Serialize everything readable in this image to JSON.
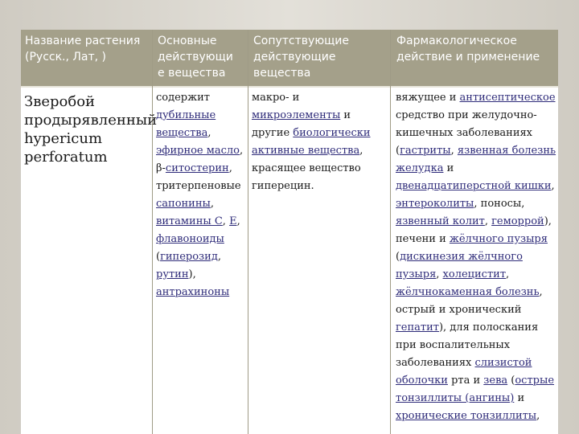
{
  "header": {
    "col1": "Название растения\n(Русск., Лат, )",
    "col2": "Основные\nдействующи\nе вещества",
    "col3": "Сопутствующие\nдействующие\nвещества",
    "col4": "Фармакологическое\nдействие и применение"
  },
  "plant": {
    "lines": [
      "Зверобой",
      "продырявленный",
      "hypericum",
      "perforatum"
    ]
  },
  "main_substances": {
    "lines": [
      [
        {
          "t": "содержит",
          "u": false
        }
      ],
      [
        {
          "t": "дубильные",
          "u": true
        }
      ],
      [
        {
          "t": "вещества",
          "u": true
        },
        {
          "t": ",",
          "u": false
        }
      ],
      [
        {
          "t": "эфирное масло",
          "u": true
        },
        {
          "t": ",",
          "u": false
        }
      ],
      [
        {
          "t": "β-",
          "u": false
        },
        {
          "t": "ситостерин",
          "u": true
        },
        {
          "t": ",",
          "u": false
        }
      ],
      [
        {
          "t": "тритерпеновые",
          "u": false
        }
      ],
      [
        {
          "t": "сапонины",
          "u": true
        },
        {
          "t": ",",
          "u": false
        }
      ],
      [
        {
          "t": "витамины С",
          "u": true
        },
        {
          "t": ", ",
          "u": false
        },
        {
          "t": "Е",
          "u": true
        },
        {
          "t": ",",
          "u": false
        }
      ],
      [
        {
          "t": "флавоноиды",
          "u": true
        }
      ],
      [
        {
          "t": "(",
          "u": false
        },
        {
          "t": "гиперозид",
          "u": true
        },
        {
          "t": ",",
          "u": false
        }
      ],
      [
        {
          "t": "рутин",
          "u": true
        },
        {
          "t": "),",
          "u": false
        }
      ],
      [
        {
          "t": "антрахиноны",
          "u": true
        }
      ]
    ]
  },
  "accompanying": {
    "lines": [
      [
        {
          "t": "макро- и",
          "u": false
        }
      ],
      [
        {
          "t": "микроэлементы",
          "u": true
        },
        {
          "t": " и",
          "u": false
        }
      ],
      [
        {
          "t": "другие ",
          "u": false
        },
        {
          "t": "биологически",
          "u": true
        }
      ],
      [
        {
          "t": "активные вещества",
          "u": true
        },
        {
          "t": ",",
          "u": false
        }
      ],
      [
        {
          "t": "красящее вещество",
          "u": false
        }
      ],
      [
        {
          "t": "гиперецин.",
          "u": false
        }
      ]
    ]
  },
  "action": {
    "lines": [
      [
        {
          "t": "вяжущее и ",
          "u": false
        },
        {
          "t": "антисептическое",
          "u": true
        }
      ],
      [
        {
          "t": "средство при желудочно-",
          "u": false
        }
      ],
      [
        {
          "t": "кишечных заболеваниях",
          "u": false
        }
      ],
      [
        {
          "t": "(",
          "u": false
        },
        {
          "t": "гастриты",
          "u": true
        },
        {
          "t": ", ",
          "u": false
        },
        {
          "t": "язвенная болезнь",
          "u": true
        }
      ],
      [
        {
          "t": "желудка",
          "u": true
        },
        {
          "t": " и",
          "u": false
        }
      ],
      [
        {
          "t": "двенадцатиперстной кишки",
          "u": true
        },
        {
          "t": ",",
          "u": false
        }
      ],
      [
        {
          "t": "энтероколиты",
          "u": true
        },
        {
          "t": ", поносы,",
          "u": false
        }
      ],
      [
        {
          "t": "язвенный колит",
          "u": true
        },
        {
          "t": ", ",
          "u": false
        },
        {
          "t": "геморрой",
          "u": true
        },
        {
          "t": "),",
          "u": false
        }
      ],
      [
        {
          "t": "печени и ",
          "u": false
        },
        {
          "t": "жёлчного пузыря",
          "u": true
        }
      ],
      [
        {
          "t": "(",
          "u": false
        },
        {
          "t": "дискинезия жёлчного",
          "u": true
        }
      ],
      [
        {
          "t": "пузыря",
          "u": true
        },
        {
          "t": ", ",
          "u": false
        },
        {
          "t": "холецистит",
          "u": true
        },
        {
          "t": ",",
          "u": false
        }
      ],
      [
        {
          "t": "жёлчнокаменная болезнь",
          "u": true
        },
        {
          "t": ",",
          "u": false
        }
      ],
      [
        {
          "t": "острый и хронический",
          "u": false
        }
      ],
      [
        {
          "t": "гепатит",
          "u": true
        },
        {
          "t": "), для полоскания",
          "u": false
        }
      ],
      [
        {
          "t": "при воспалительных",
          "u": false
        }
      ],
      [
        {
          "t": "заболеваниях ",
          "u": false
        },
        {
          "t": "слизистой",
          "u": true
        }
      ],
      [
        {
          "t": "оболочки",
          "u": true
        },
        {
          "t": " рта и ",
          "u": false
        },
        {
          "t": "зева",
          "u": true
        },
        {
          "t": " (",
          "u": false
        },
        {
          "t": "острые",
          "u": true
        }
      ],
      [
        {
          "t": "тонзиллиты (ангины)",
          "u": true
        },
        {
          "t": " и",
          "u": false
        }
      ],
      [
        {
          "t": "хронические тонзиллиты",
          "u": true
        },
        {
          "t": ",",
          "u": false
        }
      ]
    ]
  }
}
